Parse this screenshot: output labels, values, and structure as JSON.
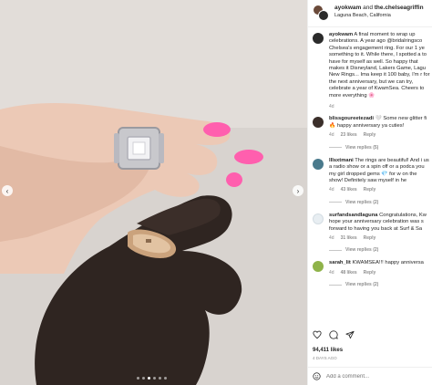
{
  "media": {
    "photo_description_icon": "ring-photo",
    "carousel": {
      "count": 6,
      "active_index": 2
    }
  },
  "header": {
    "user1": "ayokwam",
    "joiner": "and",
    "user2": "the.chelseagriffin",
    "location": "Laguna Beach, California"
  },
  "caption": {
    "username": "ayokwam",
    "text": "A final moment to wrap up celebrations. A year ago @bridalringsco Chelsea's engagement ring. For our 1 ye something to it. While there, I spotted a to have for myself as well. So happy that makes it Disneyland, Lakers Game, Lagu New Rings... Ima keep it 100 baby, I'm r for the next anniversary, but we can try, celebrate a year of KwamSea. Cheers to more everything 🌸",
    "time": "4d"
  },
  "comments": [
    {
      "username": "blissgoureetezadi",
      "text": "🤍 Some new glitter fi 🔥 happy anniversary ya cuties!",
      "time": "4d",
      "likes": "23 likes",
      "reply_label": "Reply",
      "view_replies": "View replies (5)",
      "avatar_color": "#3b2f2a"
    },
    {
      "username": "lllsxtmani",
      "text": "The rings are beautiful! And i us a radio show or a spin off or a podca you my girl dropped gems 💎 for w on the show! Definitely saw myself in he",
      "time": "4d",
      "likes": "43 likes",
      "reply_label": "Reply",
      "view_replies": "View replies (2)",
      "avatar_color": "#4a7a8c"
    },
    {
      "username": "surfandsandlaguna",
      "text": "Congratulations, Kw hope your anniversary celebration was s forward to having you back at Surf & Sa",
      "time": "4d",
      "likes": "31 likes",
      "reply_label": "Reply",
      "view_replies": "View replies (2)",
      "avatar_color": "#e8eef2"
    },
    {
      "username": "sarah_lit",
      "text": "KWAMSEA!!! happy anniversa",
      "time": "4d",
      "likes": "48 likes",
      "reply_label": "Reply",
      "view_replies": "View replies (2)",
      "avatar_color": "#8fb34a"
    }
  ],
  "footer": {
    "likes": "94,411 likes",
    "age": "4 DAYS AGO",
    "comment_placeholder": "Add a comment..."
  },
  "icons": {
    "like": "heart-icon",
    "comment": "comment-icon",
    "share": "share-icon",
    "emoji": "emoji-icon"
  }
}
